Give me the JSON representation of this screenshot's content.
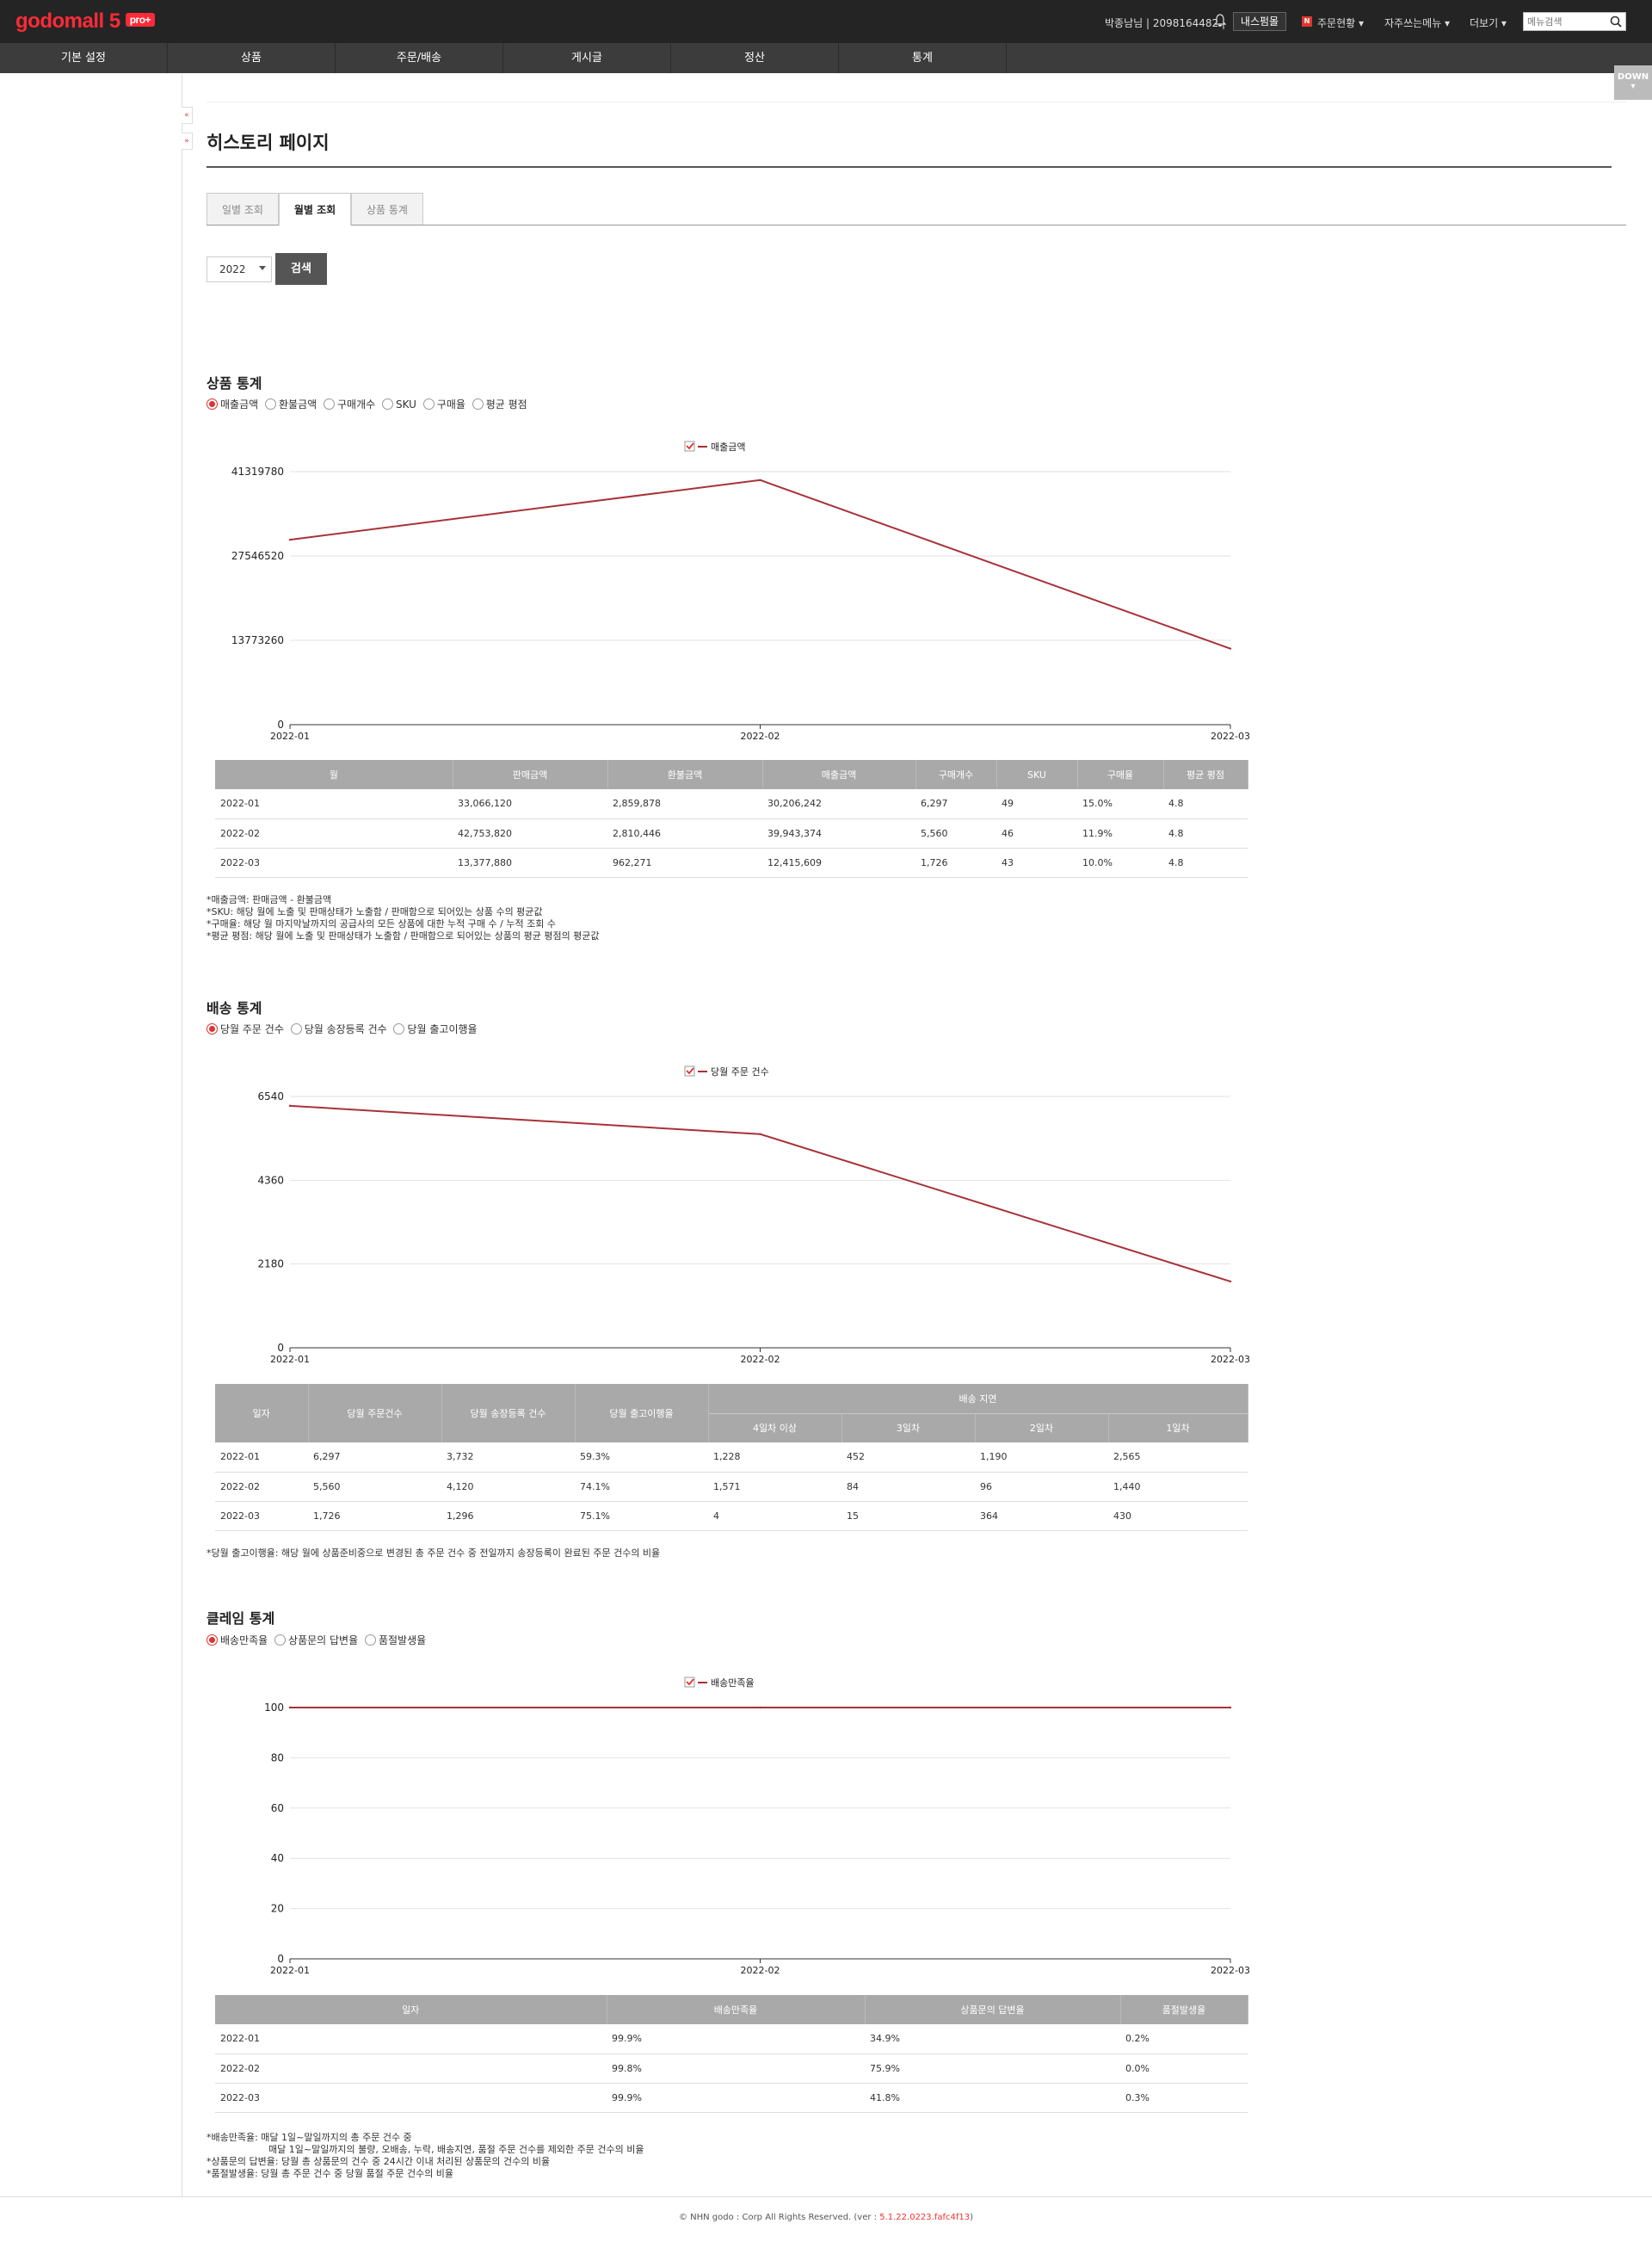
{
  "header": {
    "logo": "godomall 5",
    "logo_badge": "pro+",
    "user": "박종남님 | 2098164482 |",
    "inner_button": "내스펌몰",
    "order_status": "주문현황 ▾",
    "favorites": "자주쓰는메뉴 ▾",
    "more": "더보기 ▾",
    "menu_search_placeholder": "메뉴검색"
  },
  "gnb": [
    "기본 설정",
    "상품",
    "주문/배송",
    "게시글",
    "정산",
    "통계"
  ],
  "side_tabs": [
    "«",
    "»"
  ],
  "down_button": "DOWN",
  "page_title": "히스토리 페이지",
  "tabs": [
    {
      "label": "일별 조회",
      "active": false
    },
    {
      "label": "월별 조회",
      "active": true
    },
    {
      "label": "상품 통계",
      "active": false
    }
  ],
  "filter": {
    "year": "2022",
    "search_label": "검색"
  },
  "sections": [
    {
      "title": "상품 통계",
      "radios": [
        {
          "label": "매출금액",
          "checked": true
        },
        {
          "label": "환불금액",
          "checked": false
        },
        {
          "label": "구매개수",
          "checked": false
        },
        {
          "label": "SKU",
          "checked": false
        },
        {
          "label": "구매율",
          "checked": false
        },
        {
          "label": "평균 평점",
          "checked": false
        }
      ],
      "notes": [
        "*매출금액: 판매금액 - 환불금액",
        "*SKU: 해당 월에 노출 및 판매상태가 노출함 / 판매함으로 되어있는 상품 수의 평균값",
        "*구매율: 해당 월 마지막날까지의 공급사의 모든 상품에 대한 누적 구매 수 / 누적 조회 수",
        "*평균 평점: 해당 월에 노출 및 판매상태가 노출함 / 판매함으로 되어있는 상품의 평균 평점의 평균값"
      ]
    },
    {
      "title": "배송 통계",
      "radios": [
        {
          "label": "당월 주문 건수",
          "checked": true
        },
        {
          "label": "당월 송장등록 건수",
          "checked": false
        },
        {
          "label": "당월 출고이행율",
          "checked": false
        }
      ],
      "notes": [
        "*당월 출고이행율: 해당 월에 상품준비중으로 변경된 총 주문 건수 중 전일까지 송장등록이 완료된 주문 건수의 비율"
      ]
    },
    {
      "title": "클레임 통계",
      "radios": [
        {
          "label": "배송만족율",
          "checked": true
        },
        {
          "label": "상품문의 답변율",
          "checked": false
        },
        {
          "label": "품절발생율",
          "checked": false
        }
      ],
      "notes": [
        "*배송만족율: 매달 1일~말일까지의 총 주문 건수 중",
        "매달 1일~말일까지의 불량, 오배송, 누락, 배송지연, 품절 주문 건수를 제외한 주문 건수의 비율",
        "*상품문의 답변율: 당월 총 상품문의 건수 중 24시간 이내 처리된 상품문의 건수의 비율",
        "*품절발생율: 당월 총 주문 건수 중 당월 품절 주문 건수의 비율"
      ]
    }
  ],
  "tables": {
    "product": {
      "headers": [
        "월",
        "판매금액",
        "환불금액",
        "매출금액",
        "구매개수",
        "SKU",
        "구매율",
        "평균 평점"
      ],
      "rows": [
        [
          "2022-01",
          "33,066,120",
          "2,859,878",
          "30,206,242",
          "6,297",
          "49",
          "15.0%",
          "4.8"
        ],
        [
          "2022-02",
          "42,753,820",
          "2,810,446",
          "39,943,374",
          "5,560",
          "46",
          "11.9%",
          "4.8"
        ],
        [
          "2022-03",
          "13,377,880",
          "962,271",
          "12,415,609",
          "1,726",
          "43",
          "10.0%",
          "4.8"
        ]
      ]
    },
    "delivery": {
      "headers": [
        "일자",
        "당월 주문건수",
        "당월 송장등록 건수",
        "당월 출고이행율",
        "배송 지연"
      ],
      "sub_headers": [
        "4일차 이상",
        "3일차",
        "2일차",
        "1일차"
      ],
      "rows": [
        [
          "2022-01",
          "6,297",
          "3,732",
          "59.3%",
          "1,228",
          "452",
          "1,190",
          "2,565"
        ],
        [
          "2022-02",
          "5,560",
          "4,120",
          "74.1%",
          "1,571",
          "84",
          "96",
          "1,440"
        ],
        [
          "2022-03",
          "1,726",
          "1,296",
          "75.1%",
          "4",
          "15",
          "364",
          "430"
        ]
      ]
    },
    "claim": {
      "headers": [
        "일자",
        "배송만족율",
        "상품문의 답변율",
        "품절발생율"
      ],
      "rows": [
        [
          "2022-01",
          "99.9%",
          "34.9%",
          "0.2%"
        ],
        [
          "2022-02",
          "99.8%",
          "75.9%",
          "0.0%"
        ],
        [
          "2022-03",
          "99.9%",
          "41.8%",
          "0.3%"
        ]
      ]
    }
  },
  "chart_data": [
    {
      "type": "line",
      "x": [
        "2022-01",
        "2022-02",
        "2022-03"
      ],
      "series": [
        {
          "name": "매출금액",
          "values": [
            30206242,
            39943374,
            12415609
          ],
          "color": "#a8323a"
        }
      ],
      "yticks": [
        "0",
        "13773260",
        "27546520",
        "41319780"
      ],
      "ylim": [
        0,
        41319780
      ],
      "legend": "top-center",
      "grid": true
    },
    {
      "type": "line",
      "x": [
        "2022-01",
        "2022-02",
        "2022-03"
      ],
      "series": [
        {
          "name": "당월 주문 건수",
          "values": [
            6297,
            5560,
            1726
          ],
          "color": "#a8323a"
        }
      ],
      "yticks": [
        "0",
        "2180",
        "4360",
        "6540"
      ],
      "ylim": [
        0,
        6540
      ],
      "legend": "top-center",
      "grid": true
    },
    {
      "type": "line",
      "x": [
        "2022-01",
        "2022-02",
        "2022-03"
      ],
      "series": [
        {
          "name": "배송만족율",
          "values": [
            100,
            100,
            100
          ],
          "color": "#a8323a"
        }
      ],
      "yticks": [
        "0",
        "20",
        "40",
        "60",
        "80",
        "100"
      ],
      "ylim": [
        0,
        100
      ],
      "legend": "top-center",
      "grid": true
    }
  ],
  "footer": {
    "copyright": "© NHN godo : Corp All Rights Reserved. (ver : ",
    "version": "5.1.22.0223.fafc4f13",
    "close": ")"
  }
}
